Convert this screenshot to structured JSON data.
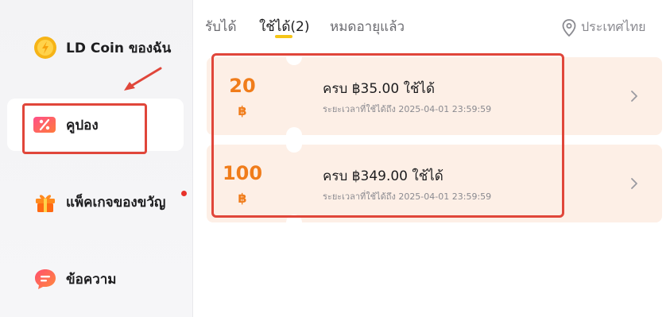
{
  "sidebar": {
    "items": [
      {
        "label": "LD Coin ของฉัน",
        "icon": "coin-icon"
      },
      {
        "label": "คูปอง",
        "icon": "coupon-icon"
      },
      {
        "label": "แพ็คเกจของขวัญ",
        "icon": "gift-icon"
      },
      {
        "label": "ข้อความ",
        "icon": "message-icon"
      }
    ]
  },
  "tabs": [
    {
      "label": "รับได้"
    },
    {
      "label": "ใช้ได้(2)"
    },
    {
      "label": "หมดอายุแล้ว"
    }
  ],
  "active_tab": "ใช้ได้(2)",
  "region": {
    "label": "ประเทศไทย",
    "icon": "location-pin-icon"
  },
  "coupons": [
    {
      "amount": "20",
      "currency": "฿",
      "condition": "ครบ ฿35.00 ใช้ได้",
      "expiry": "ระยะเวลาที่ใช้ได้ถึง 2025-04-01 23:59:59"
    },
    {
      "amount": "100",
      "currency": "฿",
      "condition": "ครบ ฿349.00 ใช้ได้",
      "expiry": "ระยะเวลาที่ใช้ได้ถึง 2025-04-01 23:59:59"
    }
  ],
  "colors": {
    "accent_orange": "#f07c1a",
    "coupon_bg": "#fdefe6",
    "tab_underline": "#f5c518",
    "annotation_red": "#e0463a",
    "notification_dot": "#e8322b"
  }
}
